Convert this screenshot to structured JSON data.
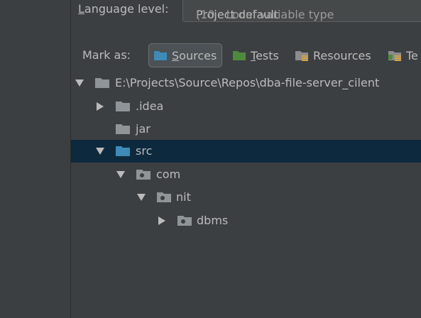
{
  "language_level": {
    "label_mnemonic": "L",
    "label_rest": "anguage level:",
    "value_main": "Project default",
    "value_muted": " (10 - Local variable type"
  },
  "mark_as": {
    "label": "Mark as:",
    "buttons": [
      {
        "mnemonic": "S",
        "rest": "ources",
        "icon": "sources-folder-icon",
        "color": "#3d8bb6",
        "active": true
      },
      {
        "mnemonic": "T",
        "rest": "ests",
        "icon": "tests-folder-icon",
        "color": "#4e8a3e",
        "active": false
      },
      {
        "mnemonic": "",
        "rest": "Resources",
        "icon": "resources-folder-icon",
        "color": "#8c8c8c",
        "active": false
      },
      {
        "mnemonic": "",
        "rest": "Te",
        "icon": "test-resources-folder-icon",
        "color": "#8c8c8c",
        "active": false
      }
    ]
  },
  "tree": {
    "nodes": [
      {
        "label": "E:\\Projects\\Source\\Repos\\dba-file-server_cilent",
        "expanded": true,
        "icon": "folder-icon",
        "selected": false
      },
      {
        "label": ".idea",
        "expanded": false,
        "icon": "folder-icon",
        "selected": false
      },
      {
        "label": "jar",
        "expanded": null,
        "icon": "folder-icon",
        "selected": false
      },
      {
        "label": "src",
        "expanded": true,
        "icon": "source-folder-icon",
        "selected": true
      },
      {
        "label": "com",
        "expanded": true,
        "icon": "package-icon",
        "selected": false
      },
      {
        "label": "nit",
        "expanded": true,
        "icon": "package-icon",
        "selected": false
      },
      {
        "label": "dbms",
        "expanded": false,
        "icon": "package-icon",
        "selected": false
      }
    ]
  },
  "colors": {
    "background": "#3c3f41",
    "selection": "#0d293e",
    "folder_gray": "#8f9498",
    "source_blue": "#3d8bb6",
    "test_green": "#4e8a3e"
  }
}
